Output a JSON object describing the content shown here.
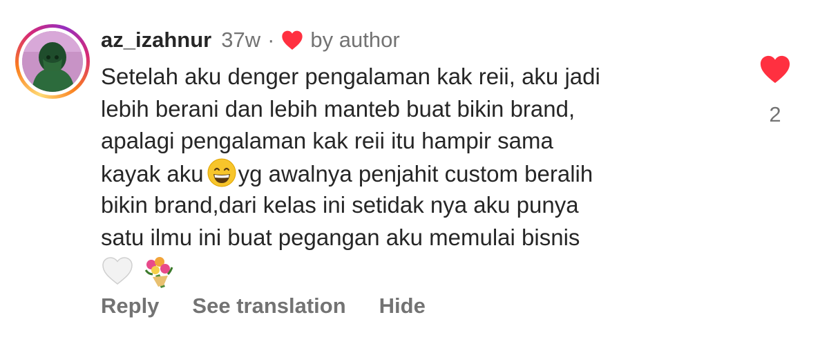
{
  "comment": {
    "username": "az_izahnur",
    "time": "37w",
    "separator": "·",
    "liked_by_author_label": "by author",
    "text_lines": [
      "Setelah aku denger pengalaman kak reii, aku jadi",
      "lebih berani dan lebih manteb buat bikin brand,",
      "apalagi pengalaman kak reii itu hampir sama",
      "kayak aku",
      "yg awalnya penjahit custom beralih",
      "bikin brand,dari kelas ini setidak nya aku punya",
      "satu ilmu ini buat pegangan aku memulai bisnis"
    ],
    "emojis": [
      "grinning-face",
      "white-heart",
      "bouquet"
    ],
    "like_count": "2",
    "actions": {
      "reply": "Reply",
      "see_translation": "See translation",
      "hide": "Hide"
    },
    "colors": {
      "heart_red": "#ff3040",
      "text": "#262626",
      "secondary": "#737373"
    }
  }
}
